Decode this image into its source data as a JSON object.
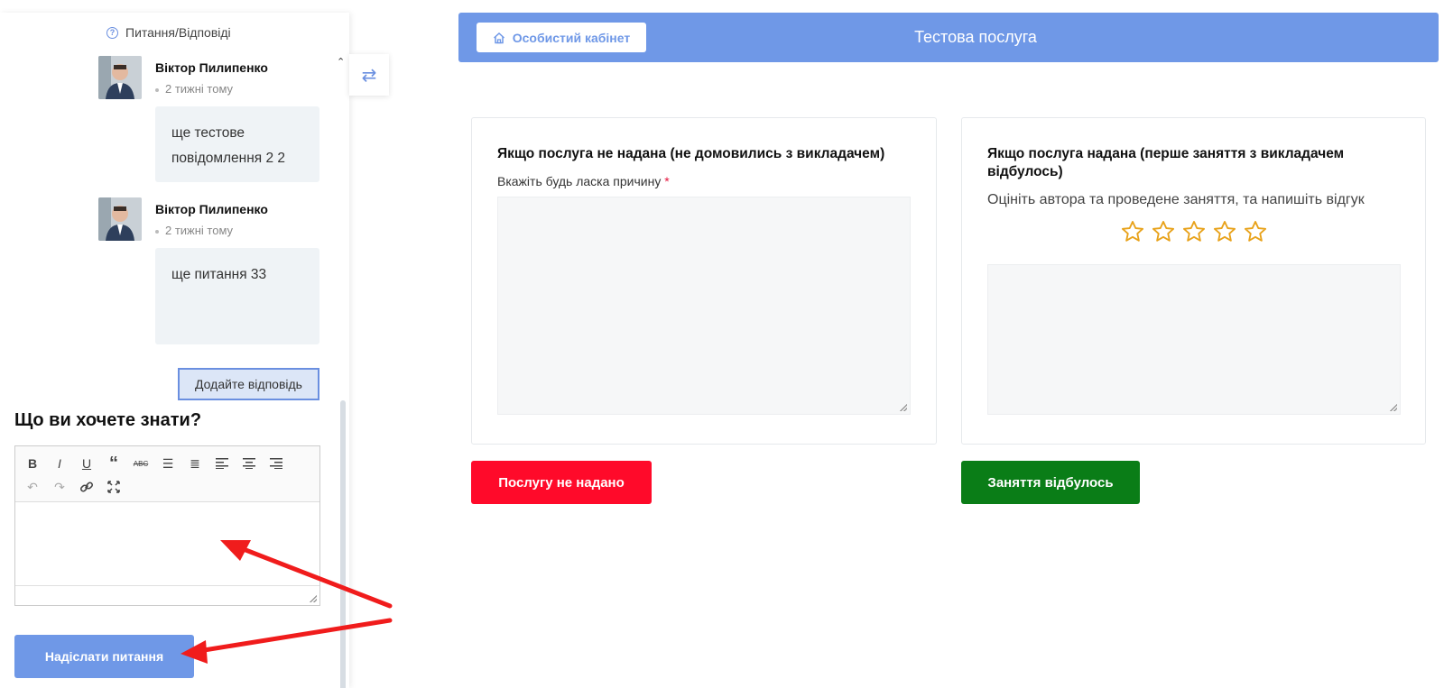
{
  "sidebar": {
    "header_label": "Питання/Відповіді",
    "messages": [
      {
        "author": "Віктор Пилипенко",
        "time": "2 тижні тому",
        "text": "ще тестове повідомлення 2 2"
      },
      {
        "author": "Віктор Пилипенко",
        "time": "2 тижні тому",
        "text": "ще питання 33"
      }
    ],
    "add_answer_label": "Додайте відповідь",
    "ask_title": "Що ви хочете знати?",
    "send_label": "Надіслати питання",
    "toolbar_icons": [
      "bold-icon",
      "italic-icon",
      "underline-icon",
      "quote-icon",
      "strikethrough-icon",
      "bullet-list-icon",
      "numbered-list-icon",
      "align-left-icon",
      "align-center-icon",
      "align-right-icon",
      "undo-icon",
      "redo-icon",
      "link-icon",
      "fullscreen-icon"
    ]
  },
  "topbar": {
    "cabinet_label": "Особистий кабінет",
    "title": "Тестова послуга"
  },
  "left_card": {
    "title": "Якщо послуга не надана (не домовились з викладачем)",
    "field_label": "Вкажіть будь ласка причину",
    "required_mark": "*",
    "button_label": "Послугу не надано"
  },
  "right_card": {
    "title": "Якщо послуга надана (перше заняття з викладачем відбулось)",
    "rating_label": "Оцініть автора та проведене заняття, та напишіть відгук",
    "rating_value": 0,
    "rating_max": 5,
    "button_label": "Заняття відбулось"
  },
  "colors": {
    "accent": "#6f98e7",
    "danger": "#ff0a2a",
    "success": "#0a7d17",
    "star": "#e8a21a",
    "annotation_arrow": "#f01c1c"
  }
}
